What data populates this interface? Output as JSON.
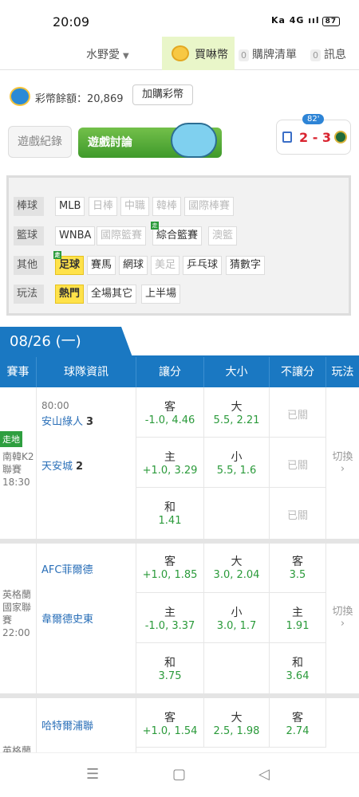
{
  "status": {
    "time": "20:09",
    "sys": "Ka 4G ııl",
    "battery": "87"
  },
  "topnav": {
    "user": "水野愛",
    "buy": "買啉幣",
    "orders_count": "0",
    "orders": "購牌清單",
    "msgs_count": "0",
    "msgs": "訊息"
  },
  "balance": {
    "label": "彩幣餘額：20,869",
    "add_button": "加購彩幣"
  },
  "tabs": {
    "record": "遊戲紀錄",
    "discuss": "遊戲討論"
  },
  "scorecard": {
    "minute": "82'",
    "score": "2 - 3"
  },
  "filters": [
    {
      "cat": "棒球",
      "chips": [
        {
          "t": "MLB"
        },
        {
          "t": "日棒",
          "dim": true
        },
        {
          "t": "中職",
          "dim": true
        },
        {
          "t": "韓棒",
          "dim": true
        },
        {
          "t": "國際棒賽",
          "dim": true
        }
      ]
    },
    {
      "cat": "籃球",
      "chips": [
        {
          "t": "WNBA"
        },
        {
          "t": "國際籃賽",
          "dim": true
        },
        {
          "t": "綜合籃賽",
          "tag": "走"
        },
        {
          "t": "澳籃",
          "dim": true
        }
      ]
    },
    {
      "cat": "其他",
      "chips": [
        {
          "t": "足球",
          "sel": true,
          "tag": "走"
        },
        {
          "t": "賽馬"
        },
        {
          "t": "網球"
        },
        {
          "t": "美足",
          "dim": true
        },
        {
          "t": "乒乓球"
        },
        {
          "t": "猜數字"
        }
      ]
    },
    {
      "cat": "玩法",
      "chips": [
        {
          "t": "熱門",
          "sel": true
        },
        {
          "t": "全場其它"
        },
        {
          "t": "上半場"
        }
      ]
    }
  ],
  "date": "08/26 (一)",
  "columns": [
    "賽事",
    "球隊資訊",
    "讓分",
    "大小",
    "不讓分",
    "玩法"
  ],
  "matches": [
    {
      "badge": "走地",
      "league": "南韓K2聯賽",
      "time": "18:30",
      "clock": "80:00",
      "away": "安山綠人",
      "away_score": "3",
      "home": "天安城",
      "home_score": "2",
      "rows": [
        {
          "spread_top": "客",
          "spread_odd": "-1.0, 4.46",
          "ou_top": "大",
          "ou_odd": "5.5, 2.21",
          "ml": "已關"
        },
        {
          "spread_top": "主",
          "spread_odd": "+1.0, 3.29",
          "ou_top": "小",
          "ou_odd": "5.5, 1.6",
          "ml": "已關"
        },
        {
          "spread_top": "和",
          "spread_odd": "1.41",
          "ou_top": "",
          "ou_odd": "",
          "ml": "已關"
        }
      ],
      "switch": "切換"
    },
    {
      "league": "英格蘭國家聯賽",
      "time": "22:00",
      "away": "AFC菲爾德",
      "home": "韋爾德史東",
      "rows": [
        {
          "spread_top": "客",
          "spread_odd": "+1.0, 1.85",
          "ou_top": "大",
          "ou_odd": "3.0, 2.04",
          "ml_top": "客",
          "ml_odd": "3.5"
        },
        {
          "spread_top": "主",
          "spread_odd": "-1.0, 3.37",
          "ou_top": "小",
          "ou_odd": "3.0, 1.7",
          "ml_top": "主",
          "ml_odd": "1.91"
        },
        {
          "spread_top": "和",
          "spread_odd": "3.75",
          "ou_top": "",
          "ou_odd": "",
          "ml_top": "和",
          "ml_odd": "3.64"
        }
      ],
      "switch": "切換"
    },
    {
      "league": "英格蘭",
      "away": "哈特爾浦聯",
      "rows": [
        {
          "spread_top": "客",
          "spread_odd": "+1.0, 1.54",
          "ou_top": "大",
          "ou_odd": "2.5, 1.98",
          "ml_top": "客",
          "ml_odd": "2.74"
        }
      ]
    }
  ],
  "navbar": {
    "menu": "☰",
    "home": "▢",
    "back": "◁"
  }
}
